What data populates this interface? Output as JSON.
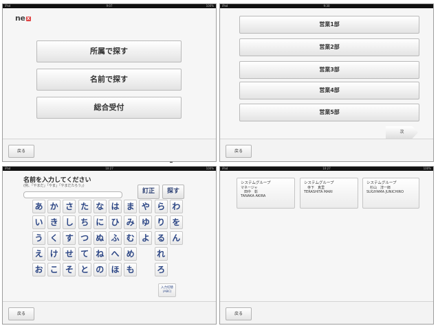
{
  "screens": [
    {
      "status": {
        "left": "iPad",
        "center": "9:07",
        "right": "100%"
      },
      "logo": {
        "text": "ne",
        "x_mark": "X"
      },
      "menu": [
        "所属で探す",
        "名前で探す",
        "総合受付"
      ],
      "back_label": "戻る"
    },
    {
      "status": {
        "left": "iPad",
        "center": "9:30",
        "right": ""
      },
      "departments": [
        "営業1部",
        "営業2部",
        "営業3部",
        "営業4部",
        "営業5部"
      ],
      "next_label": "次",
      "back_label": "戻る"
    },
    {
      "status": {
        "left": "iPad",
        "center": "10:27",
        "right": "100%"
      },
      "title": "名前を入力してください",
      "example": "(例、「やまだ」「やま」「やまだたろう」)",
      "correct_label": "訂正",
      "search_label": "探す",
      "kana_rows": [
        [
          "あ",
          "か",
          "さ",
          "た",
          "な",
          "は",
          "ま",
          "や",
          "ら",
          "わ"
        ],
        [
          "い",
          "き",
          "し",
          "ち",
          "に",
          "ひ",
          "み",
          "ゆ",
          "り",
          "を"
        ],
        [
          "う",
          "く",
          "す",
          "つ",
          "ぬ",
          "ふ",
          "む",
          "よ",
          "る",
          "ん"
        ],
        [
          "え",
          "け",
          "せ",
          "て",
          "ね",
          "へ",
          "め",
          "",
          "れ",
          ""
        ],
        [
          "お",
          "こ",
          "そ",
          "と",
          "の",
          "ほ",
          "も",
          "",
          "ろ",
          ""
        ]
      ],
      "mode_key": {
        "line1": "入力切替",
        "line2": "(ABC)"
      },
      "back_label": "戻る"
    },
    {
      "status": {
        "left": "iPad",
        "center": "10:27",
        "right": "100%"
      },
      "results": [
        {
          "group": "システムグループ",
          "role": "マネージャ",
          "name_jp": "田中　彰",
          "name_en": "TANAKA AKIRA"
        },
        {
          "group": "システムグループ",
          "role": "",
          "name_jp": "寺下　真里",
          "name_en": "TERASHITA MARI"
        },
        {
          "group": "システムグループ",
          "role": "",
          "name_jp": "杉山　淳一郎",
          "name_en": "SUGIYAMA JUNICHIRO"
        }
      ],
      "back_label": "戻る"
    }
  ]
}
